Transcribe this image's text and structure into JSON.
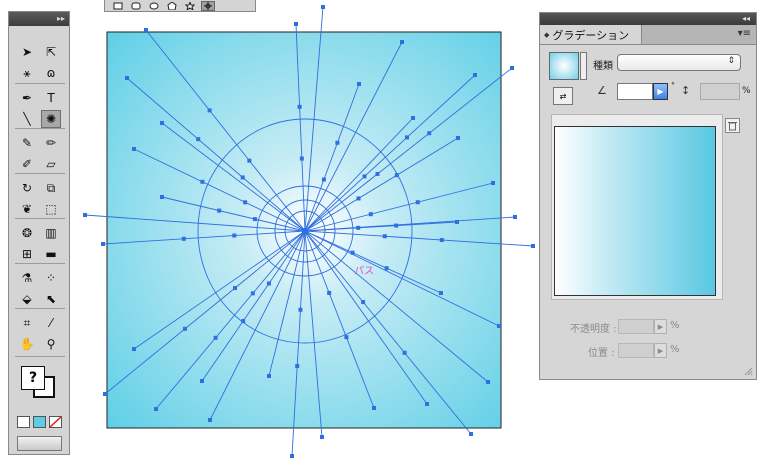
{
  "toolbox": {
    "tools": [
      {
        "name": "selection-tool-icon",
        "glyph": "➤"
      },
      {
        "name": "direct-selection-tool-icon",
        "glyph": "⇱"
      },
      {
        "name": "magic-wand-tool-icon",
        "glyph": "⚹"
      },
      {
        "name": "lasso-tool-icon",
        "glyph": "ɷ"
      },
      {
        "name": "pen-tool-icon",
        "glyph": "✒"
      },
      {
        "name": "type-tool-icon",
        "glyph": "T"
      },
      {
        "name": "line-tool-icon",
        "glyph": "╲"
      },
      {
        "name": "flare-tool-icon",
        "glyph": "✺"
      },
      {
        "name": "paintbrush-tool-icon",
        "glyph": "✎"
      },
      {
        "name": "pencil-tool-icon",
        "glyph": "✏"
      },
      {
        "name": "blob-brush-tool-icon",
        "glyph": "✐"
      },
      {
        "name": "eraser-tool-icon",
        "glyph": "▱"
      },
      {
        "name": "rotate-tool-icon",
        "glyph": "↻"
      },
      {
        "name": "scale-tool-icon",
        "glyph": "⧉"
      },
      {
        "name": "warp-tool-icon",
        "glyph": "❦"
      },
      {
        "name": "free-transform-tool-icon",
        "glyph": "⬚"
      },
      {
        "name": "symbol-sprayer-tool-icon",
        "glyph": "❂"
      },
      {
        "name": "column-graph-tool-icon",
        "glyph": "▥"
      },
      {
        "name": "mesh-tool-icon",
        "glyph": "⊞"
      },
      {
        "name": "gradient-tool-icon",
        "glyph": "▬"
      },
      {
        "name": "eyedropper-tool-icon",
        "glyph": "⚗"
      },
      {
        "name": "blend-tool-icon",
        "glyph": "⁘"
      },
      {
        "name": "live-paint-bucket-tool-icon",
        "glyph": "⬙"
      },
      {
        "name": "live-paint-selection-tool-icon",
        "glyph": "⬉"
      },
      {
        "name": "artboard-tool-icon",
        "glyph": "⌗"
      },
      {
        "name": "slice-tool-icon",
        "glyph": "⁄"
      },
      {
        "name": "hand-tool-icon",
        "glyph": "✋"
      },
      {
        "name": "zoom-tool-icon",
        "glyph": "⚲"
      }
    ],
    "fill_stroke_glyph": "?"
  },
  "shape_popup": {
    "shapes": [
      "rectangle-icon",
      "rounded-rectangle-icon",
      "ellipse-icon",
      "polygon-icon",
      "star-icon",
      "flare-icon"
    ]
  },
  "canvas": {
    "colors": {
      "bg_center": "#ffffff",
      "bg_mid": "#c7ecf5",
      "bg_edge": "#5fcfe6",
      "path": "#2f6fe0"
    },
    "path_label": "パス"
  },
  "gradient_panel": {
    "tab_title": "グラデーション",
    "type_label": "種類 :",
    "type_value": "",
    "angle_value": "",
    "degree_unit": "°",
    "aspect_value": "",
    "aspect_unit": "%",
    "opacity_label": "不透明度 :",
    "opacity_unit": "%",
    "location_label": "位置 :",
    "location_unit": "%",
    "ramp_colors": {
      "start": "#ffffff",
      "end": "#59c8e2"
    }
  }
}
